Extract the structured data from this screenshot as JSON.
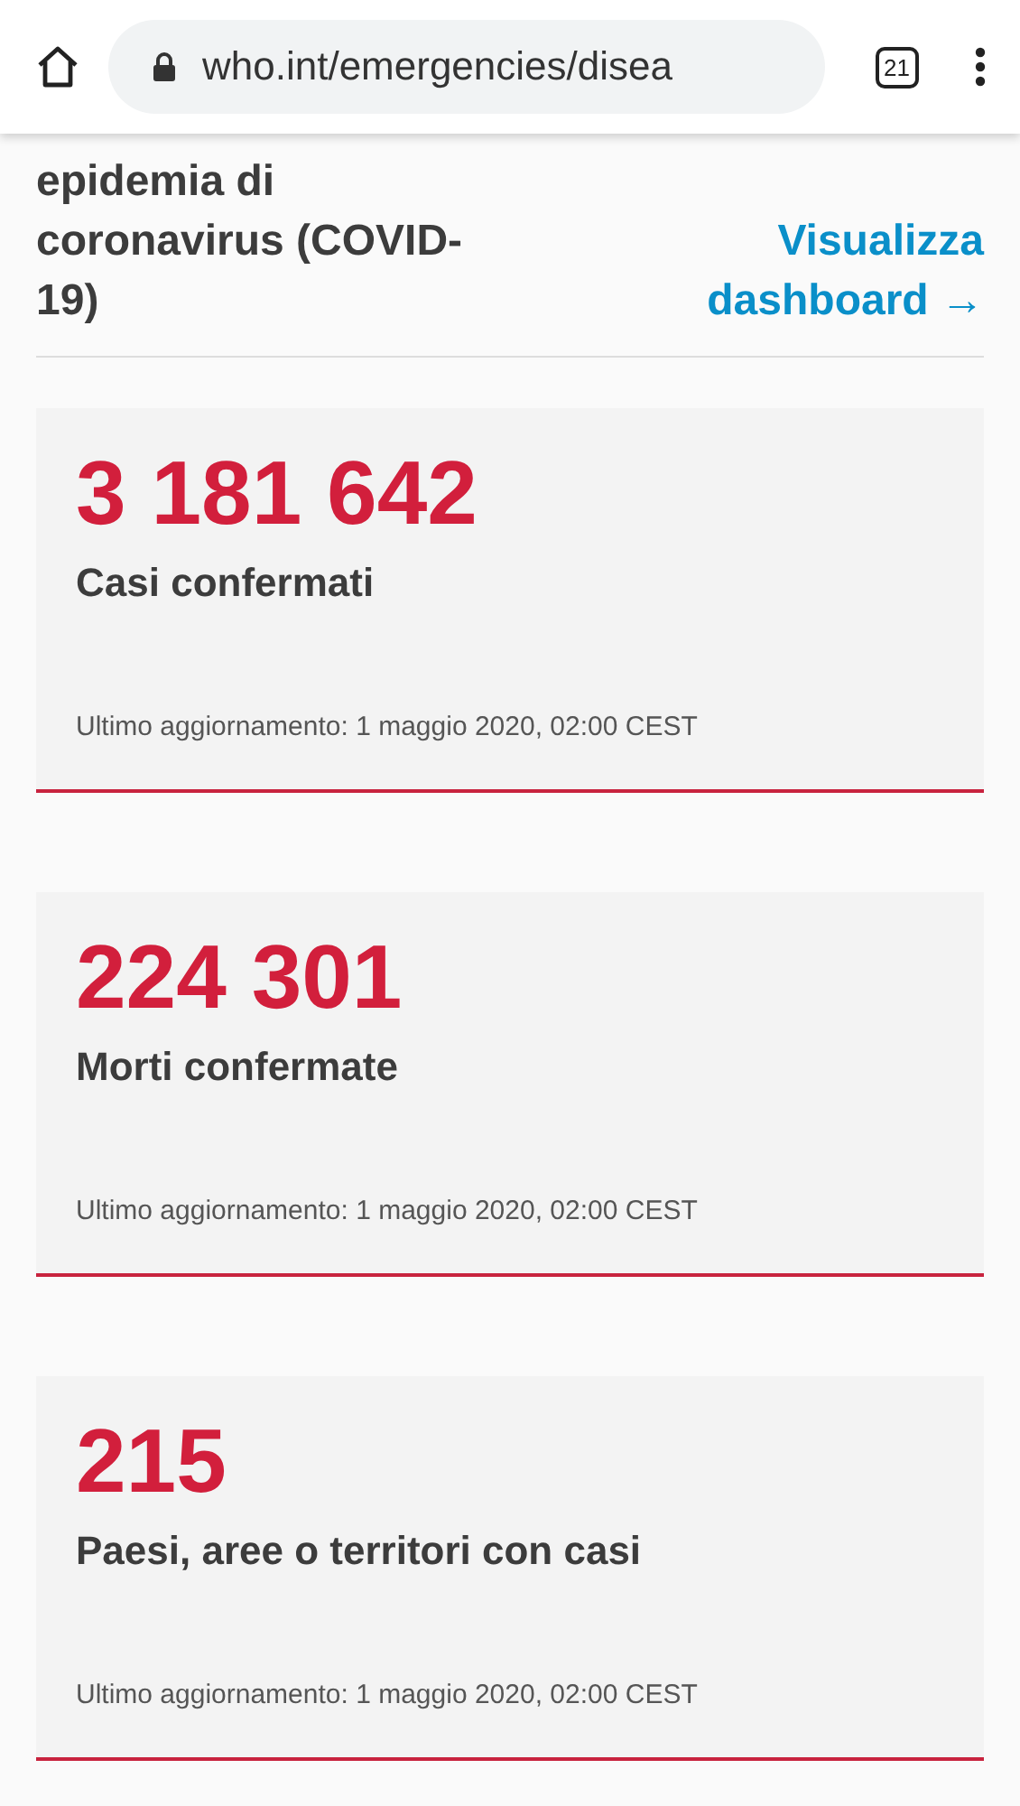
{
  "browser": {
    "url": "who.int/emergencies/disea",
    "tab_count": "21"
  },
  "heading": "epidemia di coronavirus (COVID-19)",
  "dashboard_link": "Visualizza dashboard →",
  "stats": [
    {
      "value": "3 181 642",
      "label": "Casi confermati",
      "updated": "Ultimo aggiornamento: 1 maggio 2020, 02:00 CEST"
    },
    {
      "value": "224 301",
      "label": "Morti confermate",
      "updated": "Ultimo aggiornamento: 1 maggio 2020, 02:00 CEST"
    },
    {
      "value": "215",
      "label": "Paesi, aree o territori con casi",
      "updated": "Ultimo aggiornamento: 1 maggio 2020, 02:00 CEST"
    }
  ]
}
